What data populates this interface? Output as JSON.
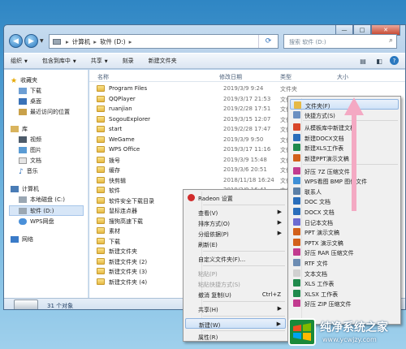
{
  "address": {
    "segments": [
      "计算机",
      "软件 (D:)"
    ],
    "search_placeholder": "搜索 软件 (D:)"
  },
  "toolbar": {
    "organize": "组织",
    "include": "包含到库中",
    "share": "共享",
    "burn": "刻录",
    "new_folder": "新建文件夹"
  },
  "nav_pane": {
    "favorites": "收藏夹",
    "downloads": "下载",
    "desktop": "桌面",
    "recent": "最近访问的位置",
    "libraries": "库",
    "videos": "视频",
    "pictures": "图片",
    "documents": "文档",
    "music": "音乐",
    "computer": "计算机",
    "local_c": "本地磁盘 (C:)",
    "soft_d": "软件 (D:)",
    "wps": "WPS网盘",
    "network": "网络"
  },
  "columns": {
    "name": "名称",
    "date": "修改日期",
    "type": "类型",
    "size": "大小"
  },
  "files": [
    {
      "name": "Program Files",
      "date": "2019/3/9 9:24",
      "type": "文件夹"
    },
    {
      "name": "QQPlayer",
      "date": "2019/3/17 21:53",
      "type": "文件夹"
    },
    {
      "name": "ruanjian",
      "date": "2019/2/28 17:51",
      "type": "文件夹"
    },
    {
      "name": "SogouExplorer",
      "date": "2019/3/15 12:07",
      "type": "文件夹"
    },
    {
      "name": "start",
      "date": "2019/2/28 17:47",
      "type": "文件夹"
    },
    {
      "name": "WeGame",
      "date": "2019/3/9 9:50",
      "type": "文件夹"
    },
    {
      "name": "WPS Office",
      "date": "2019/3/17 11:16",
      "type": "文件夹"
    },
    {
      "name": "拨号",
      "date": "2019/3/9 15:48",
      "type": "文件夹"
    },
    {
      "name": "缓存",
      "date": "2019/3/6 20:51",
      "type": "文件夹"
    },
    {
      "name": "快剪辑",
      "date": "2018/11/18 16:24",
      "type": "文件夹"
    },
    {
      "name": "软件",
      "date": "2019/3/9 16:41",
      "type": "文件夹"
    },
    {
      "name": "软件安全下载目录",
      "date": "",
      "type": ""
    },
    {
      "name": "鼠标连点器",
      "date": "",
      "type": ""
    },
    {
      "name": "搜狗高速下载",
      "date": "",
      "type": ""
    },
    {
      "name": "素材",
      "date": "",
      "type": ""
    },
    {
      "name": "下载",
      "date": "",
      "type": ""
    },
    {
      "name": "新建文件夹",
      "date": "",
      "type": ""
    },
    {
      "name": "新建文件夹 (2)",
      "date": "",
      "type": ""
    },
    {
      "name": "新建文件夹 (3)",
      "date": "",
      "type": ""
    },
    {
      "name": "新建文件夹 (4)",
      "date": "",
      "type": ""
    }
  ],
  "status": {
    "count": "31 个对象"
  },
  "context_menu": {
    "radeon": "Radeon 设置",
    "view": "查看(V)",
    "sort": "排序方式(O)",
    "group": "分组依据(P)",
    "refresh": "刷新(E)",
    "customize": "自定义文件夹(F)...",
    "paste": "粘贴(P)",
    "paste_shortcut": "粘贴快捷方式(S)",
    "undo": "撤消 复制(U)",
    "undo_shortcut": "Ctrl+Z",
    "share": "共享(H)",
    "new": "新建(W)",
    "properties": "属性(R)"
  },
  "submenu": {
    "folder": "文件夹(F)",
    "shortcut": "快捷方式(S)",
    "template": "从模板库中新建文档",
    "docx_new": "新建DOCX文档",
    "xlsx_new": "新建XLS工作表",
    "ppt_new": "新建PPT演示文稿",
    "haozip7z": "好压 7Z 压缩文件",
    "bmp": "WPS看图 BMP 图像文件",
    "contact": "联系人",
    "doc": "DOC 文档",
    "docx": "DOCX 文档",
    "journal": "日记本文档",
    "ppt": "PPT 演示文稿",
    "pptx": "PPTX 演示文稿",
    "haoziprar": "好压 RAR 压缩文件",
    "rtf": "RTF 文件",
    "txt": "文本文档",
    "xls": "XLS 工作表",
    "xlsx": "XLSX 工作表",
    "haozipzip": "好压 ZIP 压缩文件"
  },
  "watermark": {
    "title": "纯净系统之家",
    "url": "www.ycwjzy.com"
  }
}
